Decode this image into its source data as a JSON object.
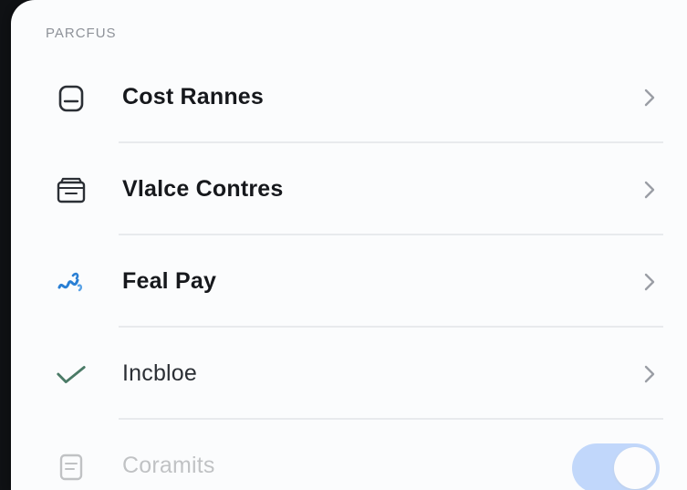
{
  "section": {
    "header": "PARCFUS"
  },
  "rows": [
    {
      "label": "Cost Rannes",
      "icon": "card-icon"
    },
    {
      "label": "Vlalce Contres",
      "icon": "wallet-icon"
    },
    {
      "label": "Feal Pay",
      "icon": "wave-icon"
    },
    {
      "label": "Incbloe",
      "icon": "checkmark-icon"
    },
    {
      "label": "Coramits",
      "icon": "document-icon",
      "toggle_on": true
    }
  ],
  "colors": {
    "accent": "#2f7bf6",
    "wave_icon": "#2a7fd4",
    "check_icon": "#4a7a66"
  }
}
